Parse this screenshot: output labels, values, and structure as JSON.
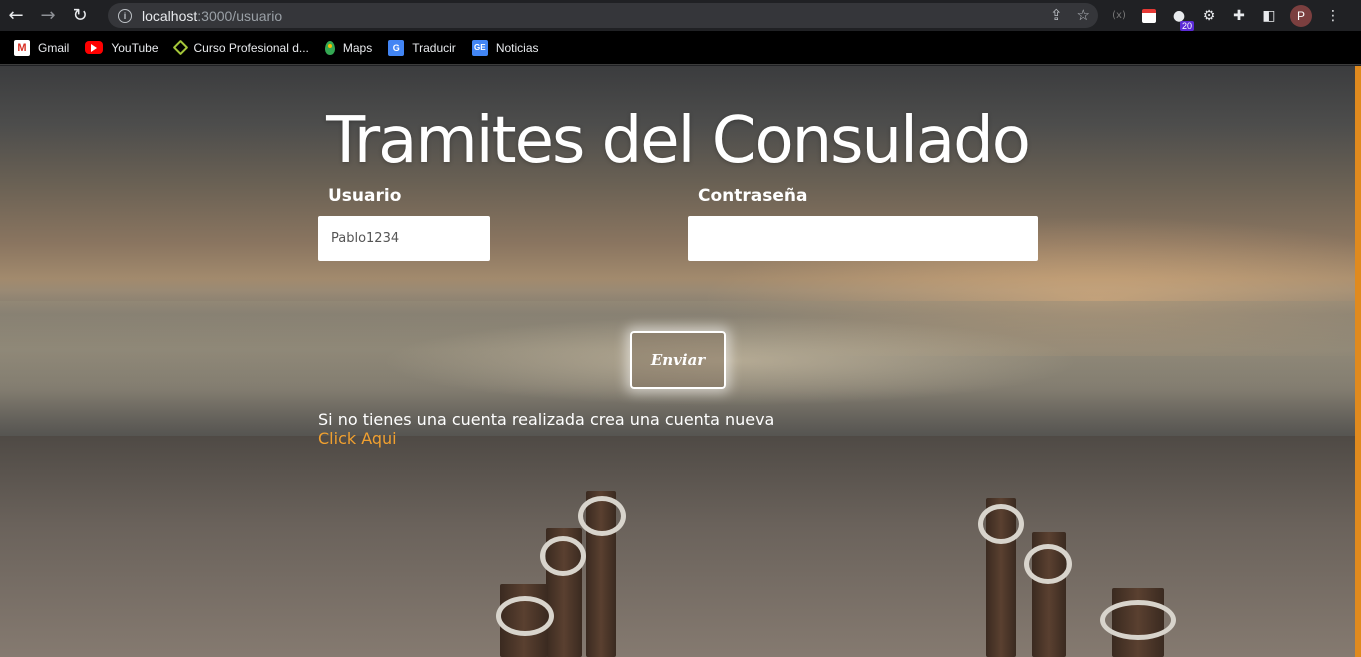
{
  "browser": {
    "url_host": "localhost",
    "url_rest": ":3000/usuario",
    "back_icon": "back-arrow-icon",
    "forward_icon": "forward-arrow-icon",
    "reload_icon": "reload-icon",
    "extension_badge": "20",
    "profile_initial": "P",
    "bookmarks": [
      {
        "label": "Gmail",
        "icon": "gmail-icon"
      },
      {
        "label": "YouTube",
        "icon": "youtube-icon"
      },
      {
        "label": "Curso Profesional d...",
        "icon": "course-icon"
      },
      {
        "label": "Maps",
        "icon": "maps-icon"
      },
      {
        "label": "Traducir",
        "icon": "translate-icon"
      },
      {
        "label": "Noticias",
        "icon": "news-icon"
      }
    ]
  },
  "page": {
    "title": "Tramites del Consulado",
    "username_label": "Usuario",
    "username_value": "Pablo1234",
    "password_label": "Contraseña",
    "password_value": "",
    "submit_label": "Enviar",
    "signup_text": "Si no tienes una cuenta realizada crea una cuenta nueva",
    "signup_link": "Click Aqui",
    "colors": {
      "link": "#f0a030",
      "accent_scrollbar": "#e08a1e"
    }
  }
}
